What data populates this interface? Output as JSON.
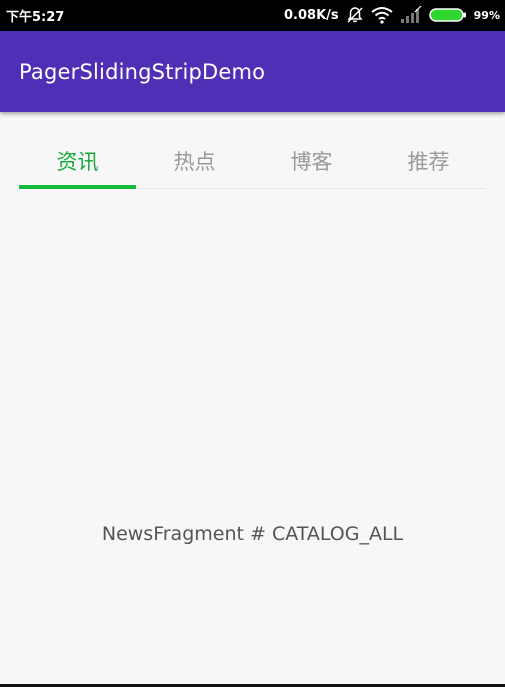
{
  "status_bar": {
    "time": "下午5:27",
    "network_speed": "0.08K/s",
    "battery_percent": "99%",
    "icons": [
      "mute-bell-icon",
      "wifi-icon",
      "signal-icon",
      "battery-icon"
    ],
    "battery_color": "#2fd62f"
  },
  "app_bar": {
    "title": "PagerSlidingStripDemo",
    "color": "#4f2fb5"
  },
  "tabs": {
    "items": [
      {
        "label": "资讯"
      },
      {
        "label": "热点"
      },
      {
        "label": "博客"
      },
      {
        "label": "推荐"
      }
    ],
    "selected": "资讯",
    "accent_color": "#15bb3d"
  },
  "fragment": {
    "text": "NewsFragment # CATALOG_ALL"
  }
}
